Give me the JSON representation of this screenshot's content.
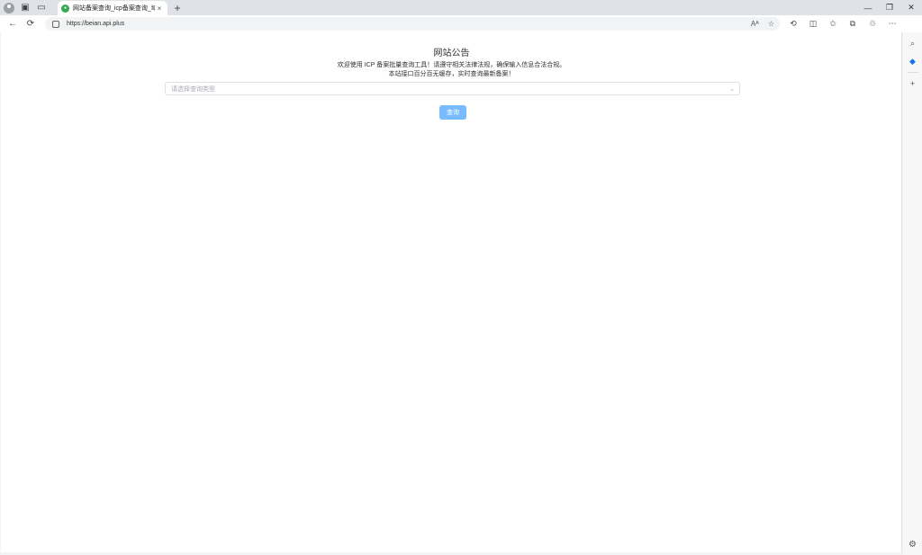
{
  "browser": {
    "tab": {
      "title": "网站备案查询_icp备案查询_域名备",
      "close_glyph": "×"
    },
    "new_tab_glyph": "+",
    "window_controls": {
      "minimize": "—",
      "restore": "❐",
      "close": "✕"
    },
    "nav": {
      "back": "←",
      "reload": "⟳"
    },
    "url": "https://beian.api.plus",
    "omnibox_icons": {
      "read_aloud": "Aᴬ",
      "favorite": "☆"
    },
    "toolbar_icons": [
      "⟲",
      "◫",
      "✩",
      "⧉",
      "♲",
      "⋯"
    ],
    "sidebar_icons": [
      "⌕",
      "◆",
      "+"
    ],
    "settings_glyph": "⚙"
  },
  "page": {
    "notice_title": "网站公告",
    "notice_line1": "欢迎使用 ICP 备案批量查询工具！请遵守相关法律法规，确保输入信息合法合规。",
    "notice_line2": "本站接口百分百无缓存，实时查询最新备案！",
    "select_placeholder": "请选择查询类型",
    "select_arrow": "⌄",
    "query_button": "查询"
  },
  "colors": {
    "primary_button": "#79bbff",
    "placeholder": "#a8abb2",
    "border": "#dcdfe6",
    "favicon": "#34a853"
  }
}
